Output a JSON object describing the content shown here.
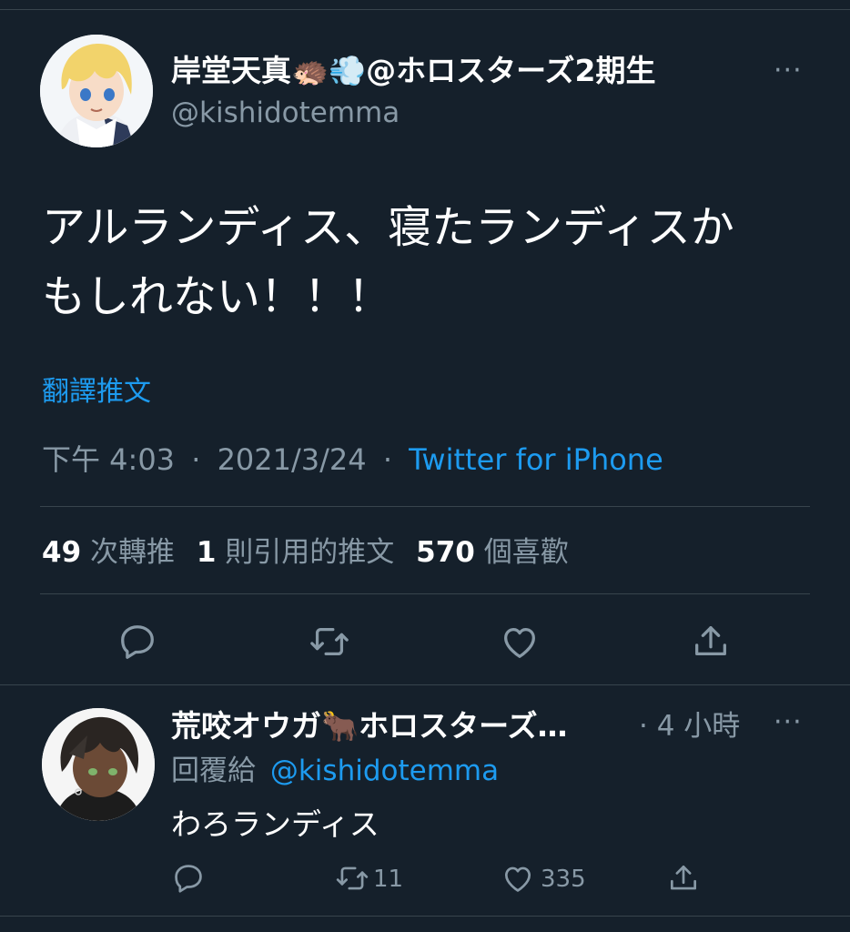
{
  "colors": {
    "background": "#15202b",
    "text": "#ffffff",
    "muted": "#8899a6",
    "link": "#1d9bf0",
    "divider": "#38444d"
  },
  "tweet": {
    "display_name": "岸堂天真🦔💨@ホロスターズ2期生",
    "handle": "@kishidotemma",
    "more": "···",
    "text_line1": "アルランディス、寝たランディスか",
    "text_line2": "もしれない！！！",
    "translate": "翻譯推文",
    "time": "下午 4:03",
    "sep1": "·",
    "date": "2021/3/24",
    "sep2": "·",
    "source": "Twitter for iPhone",
    "stats": {
      "retweets_count": "49",
      "retweets_label": "次轉推",
      "quotes_count": "1",
      "quotes_label": "則引用的推文",
      "likes_count": "570",
      "likes_label": "個喜歡"
    },
    "actions": [
      "reply-icon",
      "retweet-icon",
      "like-icon",
      "share-icon"
    ]
  },
  "reply": {
    "display_name": "荒咬オウガ🐂ホロスターズ…",
    "time": "· 4 小時",
    "more": "···",
    "replying_label": "回覆給",
    "replying_handle": "@kishidotemma",
    "text": "わろランディス",
    "retweet_count": "11",
    "like_count": "335"
  }
}
